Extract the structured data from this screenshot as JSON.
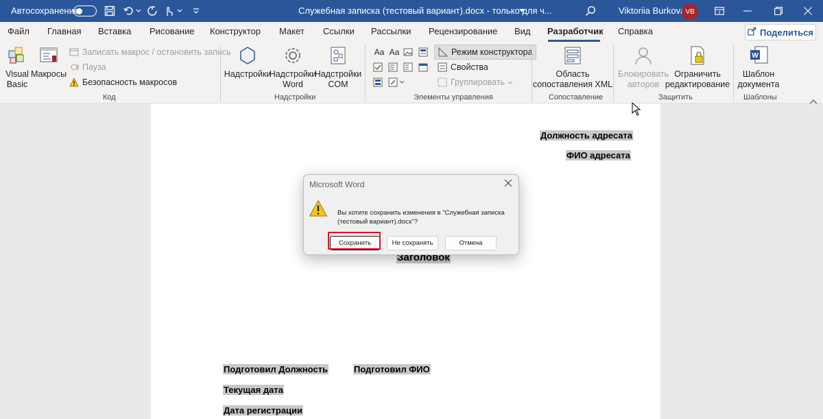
{
  "titlebar": {
    "autosave_label": "Автосохранение",
    "document_title": "Служебная записка (тестовый вариант).docx  -  только для ч...",
    "user_name": "Viktoriia Burkova",
    "avatar_initials": "VB",
    "accent_color": "#2b579a",
    "avatar_color": "#a4262c"
  },
  "menu": {
    "tabs": [
      "Файл",
      "Главная",
      "Вставка",
      "Рисование",
      "Конструктор",
      "Макет",
      "Ссылки",
      "Рассылки",
      "Рецензирование",
      "Вид",
      "Разработчик",
      "Справка"
    ],
    "active_tab": "Разработчик",
    "share_label": "Поделиться"
  },
  "ribbon": {
    "code": {
      "visual_basic": "Visual\nBasic",
      "macros": "Макросы",
      "record_macro": "Записать макрос / остановить запись",
      "pause": "Пауза",
      "macro_security": "Безопасность макросов",
      "label": "Код"
    },
    "addins": {
      "addins": "Надстройки",
      "word_addins": "Надстройки\nWord",
      "com_addins": "Надстройки\nCOM",
      "label": "Надстройки"
    },
    "controls": {
      "design_mode": "Режим конструктора",
      "properties": "Свойства",
      "group": "Группировать",
      "label": "Элементы управления"
    },
    "mapping": {
      "xml_pane": "Область\nсопоставления XML",
      "label": "Сопоставление"
    },
    "protect": {
      "block_authors": "Блокировать\nавторов",
      "restrict_editing": "Ограничить\nредактирование",
      "label": "Защитить"
    },
    "templates": {
      "document_template": "Шаблон\nдокумента",
      "label": "Шаблоны"
    }
  },
  "document": {
    "recipient_position": "Должность адресата",
    "recipient_name": "ФИО адресата",
    "heading": "Заголовок",
    "prepared_position": "Подготовил Должность",
    "prepared_name": "Подготовил ФИО",
    "current_date": "Текущая дата",
    "registration_date": "Дата регистрации"
  },
  "dialog": {
    "title": "Microsoft Word",
    "message": "Вы хотите сохранить изменения в \"Служебная записка (тестовый вариант).docx\"?",
    "save_button": "Сохранить",
    "dont_save_button": "Не сохранять",
    "cancel_button": "Отмена",
    "highlight_color": "#e81123"
  }
}
